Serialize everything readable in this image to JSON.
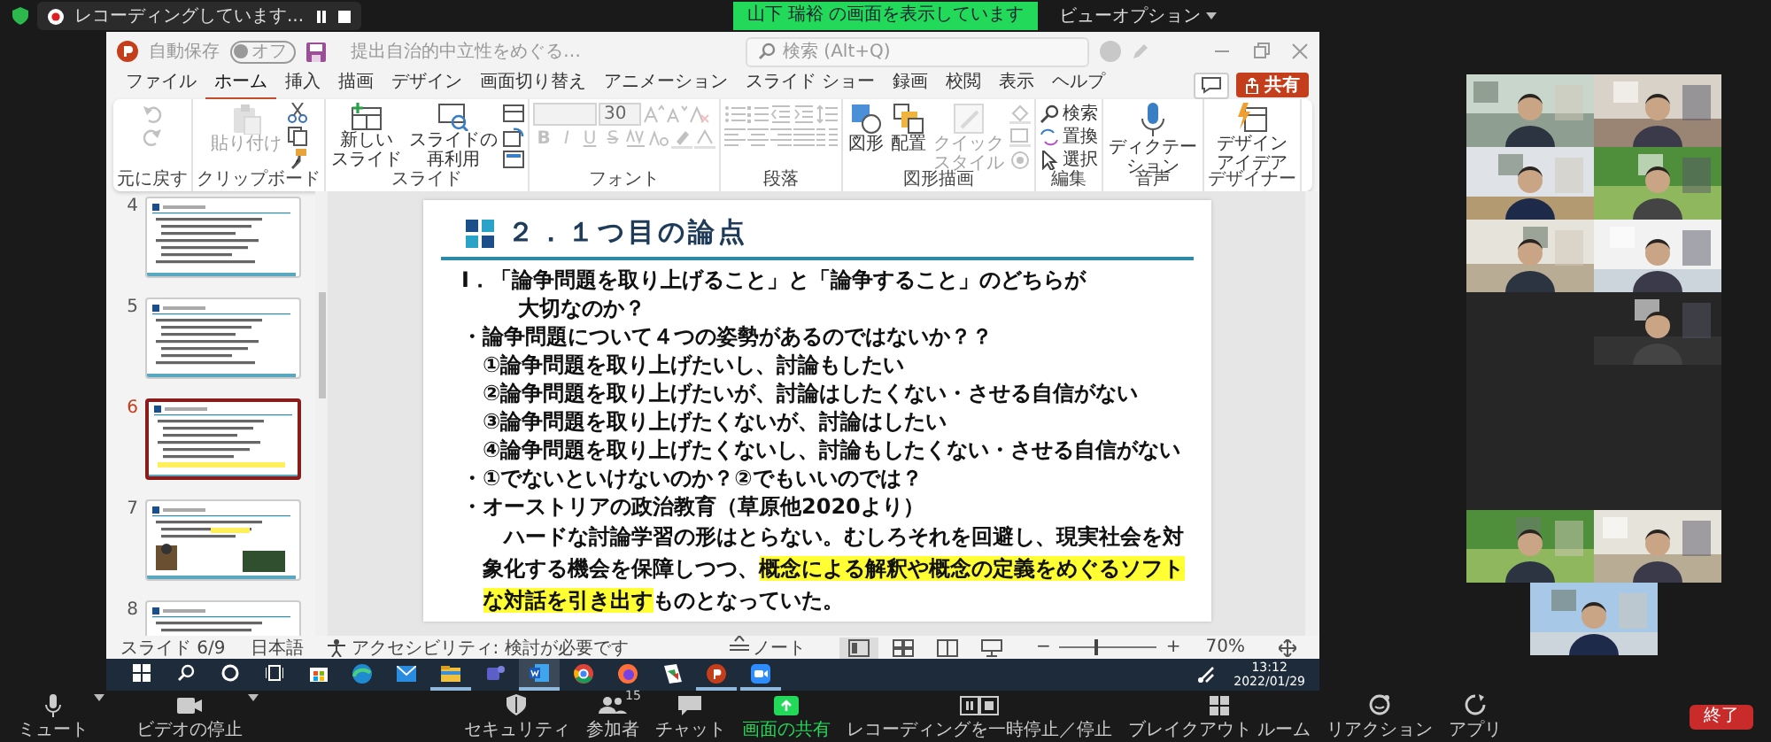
{
  "zoom_top": {
    "recording": "レコーディングしています...",
    "share_banner": "山下 瑞裕 の画面を表示しています",
    "view_options": "ビューオプション"
  },
  "powerpoint": {
    "autosave_label": "自動保存",
    "autosave": {
      "on": false,
      "label": "オフ"
    },
    "file_name": "提出自治的中立性をめぐる…",
    "search_placeholder": "検索 (Alt+Q)",
    "tabs": [
      {
        "label": "ファイル",
        "selected": false
      },
      {
        "label": "ホーム",
        "selected": true
      },
      {
        "label": "挿入",
        "selected": false
      },
      {
        "label": "描画",
        "selected": false
      },
      {
        "label": "デザイン",
        "selected": false
      },
      {
        "label": "画面切り替え",
        "selected": false
      },
      {
        "label": "アニメーション",
        "selected": false
      },
      {
        "label": "スライド ショー",
        "selected": false
      },
      {
        "label": "録画",
        "selected": false
      },
      {
        "label": "校閲",
        "selected": false
      },
      {
        "label": "表示",
        "selected": false
      },
      {
        "label": "ヘルプ",
        "selected": false
      }
    ],
    "share_button": "共有",
    "ribbon": [
      {
        "label": "元に戻す",
        "items": [
          {
            "kind": "stack",
            "rows": [
              {
                "buttons": [
                  {
                    "kind": "undo",
                    "disabled": true
                  }
                ]
              },
              {
                "buttons": [
                  {
                    "kind": "redo",
                    "disabled": true
                  }
                ]
              }
            ]
          }
        ]
      },
      {
        "label": "クリップボード",
        "items": [
          {
            "kind": "paste",
            "label": [
              "貼り付け"
            ],
            "disabled": true
          },
          {
            "kind": "stack",
            "rows": [
              {
                "buttons": [
                  {
                    "kind": "cut",
                    "disabled": false
                  }
                ]
              },
              {
                "buttons": [
                  {
                    "kind": "copy",
                    "disabled": false
                  }
                ]
              },
              {
                "buttons": [
                  {
                    "kind": "format_painter",
                    "disabled": false
                  }
                ]
              }
            ]
          }
        ]
      },
      {
        "label": "スライド",
        "items": [
          {
            "kind": "new_slide",
            "label": [
              "新しい",
              "スライド"
            ],
            "disabled": false
          },
          {
            "kind": "reuse_slides",
            "label": [
              "スライドの",
              "再利用"
            ],
            "disabled": false
          },
          {
            "kind": "stack",
            "rows": [
              {
                "buttons": [
                  {
                    "kind": "layout",
                    "disabled": false
                  }
                ]
              },
              {
                "buttons": [
                  {
                    "kind": "reset",
                    "disabled": false
                  }
                ]
              },
              {
                "buttons": [
                  {
                    "kind": "section",
                    "disabled": false
                  }
                ]
              }
            ]
          }
        ]
      },
      {
        "label": "フォント",
        "items": [
          {
            "kind": "stack",
            "rows": [
              {
                "buttons": [
                  {
                    "kind": "font_name",
                    "disabled": true
                  },
                  {
                    "kind": "font_size",
                    "value": "30",
                    "disabled": true
                  },
                  {
                    "kind": "grow",
                    "disabled": true
                  },
                  {
                    "kind": "shrink",
                    "disabled": true
                  },
                  {
                    "kind": "clear_format",
                    "disabled": true
                  }
                ]
              },
              {
                "buttons": [
                  {
                    "kind": "bold",
                    "label": "B",
                    "disabled": true
                  },
                  {
                    "kind": "italic",
                    "label": "I",
                    "disabled": true
                  },
                  {
                    "kind": "underline",
                    "label": "U",
                    "disabled": true
                  },
                  {
                    "kind": "strike",
                    "label": "S",
                    "disabled": true
                  },
                  {
                    "kind": "char_spacing",
                    "disabled": true
                  },
                  {
                    "kind": "change_case",
                    "disabled": true
                  },
                  {
                    "kind": "highlighter",
                    "disabled": true
                  },
                  {
                    "kind": "font_color",
                    "disabled": true
                  }
                ]
              }
            ]
          }
        ]
      },
      {
        "label": "段落",
        "items": [
          {
            "kind": "stack",
            "rows": [
              {
                "buttons": [
                  {
                    "kind": "bullets",
                    "disabled": true
                  },
                  {
                    "kind": "numbering",
                    "disabled": true
                  },
                  {
                    "kind": "indent_less",
                    "disabled": true
                  },
                  {
                    "kind": "indent_more",
                    "disabled": true
                  },
                  {
                    "kind": "line_spacing",
                    "disabled": true
                  }
                ]
              },
              {
                "buttons": [
                  {
                    "kind": "align_left",
                    "disabled": true
                  },
                  {
                    "kind": "align_center",
                    "disabled": true
                  },
                  {
                    "kind": "align_right",
                    "disabled": true
                  },
                  {
                    "kind": "justify",
                    "disabled": true
                  },
                  {
                    "kind": "columns",
                    "disabled": true
                  }
                ]
              }
            ]
          }
        ]
      },
      {
        "label": "図形描画",
        "items": [
          {
            "kind": "shapes",
            "label": [
              "図形"
            ],
            "disabled": false
          },
          {
            "kind": "arrange",
            "label": [
              "配置"
            ],
            "disabled": false
          },
          {
            "kind": "quick_styles",
            "label": [
              "クイック",
              "スタイル"
            ],
            "disabled": true
          },
          {
            "kind": "stack",
            "rows": [
              {
                "buttons": [
                  {
                    "kind": "fill",
                    "disabled": true
                  }
                ]
              },
              {
                "buttons": [
                  {
                    "kind": "outline",
                    "disabled": true
                  }
                ]
              },
              {
                "buttons": [
                  {
                    "kind": "effects",
                    "disabled": true
                  }
                ]
              }
            ]
          }
        ]
      },
      {
        "label": "編集",
        "items": [
          {
            "kind": "stack",
            "rows": [
              {
                "buttons": [
                  {
                    "kind": "find",
                    "label": "検索",
                    "disabled": false
                  }
                ]
              },
              {
                "buttons": [
                  {
                    "kind": "replace",
                    "label": "置換",
                    "disabled": false
                  }
                ]
              },
              {
                "buttons": [
                  {
                    "kind": "select",
                    "label": "選択",
                    "disabled": false
                  }
                ]
              }
            ]
          }
        ]
      },
      {
        "label": "音声",
        "items": [
          {
            "kind": "dictate",
            "label": [
              "ディクテー",
              "ション"
            ],
            "disabled": false
          }
        ]
      },
      {
        "label": "デザイナー",
        "items": [
          {
            "kind": "designer",
            "label": [
              "デザイン",
              "アイデア"
            ],
            "disabled": false
          }
        ]
      }
    ],
    "thumbnails": [
      {
        "number": "4",
        "selected": false,
        "kind": "text"
      },
      {
        "number": "5",
        "selected": false,
        "kind": "text"
      },
      {
        "number": "6",
        "selected": true,
        "kind": "text"
      },
      {
        "number": "7",
        "selected": false,
        "kind": "images"
      },
      {
        "number": "8",
        "selected": false,
        "kind": "text"
      }
    ],
    "slide": {
      "title": "２．１つ目の論点",
      "lines": [
        {
          "kind": "question",
          "text": "Ⅰ．「論争問題を取り上げること」と「論争すること」のどちらが"
        },
        {
          "kind": "continuation",
          "text": "大切なのか？"
        },
        {
          "kind": "bullet",
          "text": "・論争問題について４つの姿勢があるのではないか？？"
        },
        {
          "kind": "item",
          "text": "①論争問題を取り上げたいし、討論もしたい"
        },
        {
          "kind": "item",
          "text": "②論争問題を取り上げたいが、討論はしたくない・させる自信がない"
        },
        {
          "kind": "item",
          "text": "③論争問題を取り上げたくないが、討論はしたい"
        },
        {
          "kind": "item",
          "text": "④論争問題を取り上げたくないし、討論もしたくない・させる自信がない"
        },
        {
          "kind": "bullet",
          "text": "・①でないといけないのか？②でもいいのでは？"
        },
        {
          "kind": "bullet",
          "text": "・オーストリアの政治教育（草原他2020より）"
        },
        {
          "kind": "paragraph",
          "segments": [
            {
              "text": "ハードな討論学習の形はとらない。むしろそれを回避し、現実社会を対象化する機会を保障しつつ、",
              "highlight": false
            },
            {
              "text": "概念による解釈や概念の定義をめぐるソフトな対話を引き出す",
              "highlight": true
            },
            {
              "text": "ものとなっていた。",
              "highlight": false
            }
          ]
        }
      ]
    },
    "status": {
      "slide_number": "スライド 6/9",
      "language": "日本語",
      "accessibility": "アクセシビリティ: 検討が必要です",
      "notes": "ノート",
      "views": [
        {
          "kind": "normal",
          "selected": true
        },
        {
          "kind": "sorter",
          "selected": false
        },
        {
          "kind": "reading",
          "selected": false
        },
        {
          "kind": "slideshow",
          "selected": false
        }
      ],
      "zoom_out": "−",
      "zoom_in": "+",
      "zoom": {
        "level": 0.35
      },
      "zoom_text": "70%"
    }
  },
  "taskbar": {
    "apps": [
      {
        "kind": "start",
        "running": false,
        "active": false
      },
      {
        "kind": "search",
        "running": false,
        "active": false
      },
      {
        "kind": "cortana",
        "running": false,
        "active": false
      },
      {
        "kind": "taskview",
        "running": false,
        "active": false
      },
      {
        "kind": "store",
        "running": false,
        "active": false
      },
      {
        "kind": "edge",
        "running": false,
        "active": false
      },
      {
        "kind": "mail",
        "running": false,
        "active": false
      },
      {
        "kind": "explorer",
        "running": true,
        "active": false
      },
      {
        "kind": "teams",
        "running": false,
        "active": false
      },
      {
        "kind": "word",
        "running": true,
        "active": true
      },
      {
        "kind": "chrome",
        "running": false,
        "active": false
      },
      {
        "kind": "firefox",
        "running": false,
        "active": false
      },
      {
        "kind": "app",
        "running": false,
        "active": false
      },
      {
        "kind": "powerpoint",
        "running": true,
        "active": false
      },
      {
        "kind": "zoom",
        "running": true,
        "active": false
      }
    ],
    "time": "13:12",
    "date": "2022/01/29"
  },
  "gallery": [
    {
      "kind": "video"
    },
    {
      "kind": "video"
    },
    {
      "kind": "video"
    },
    {
      "kind": "video"
    },
    {
      "kind": "video"
    },
    {
      "kind": "video"
    },
    {
      "kind": "camera_off"
    },
    {
      "kind": "video"
    },
    {
      "kind": "camera_off"
    },
    {
      "kind": "camera_off"
    },
    {
      "kind": "camera_off"
    },
    {
      "kind": "camera_off"
    },
    {
      "kind": "video"
    },
    {
      "kind": "video"
    },
    {
      "kind": "video"
    }
  ],
  "toolbar": {
    "left": [
      {
        "kind": "mute",
        "label": "ミュート"
      },
      {
        "kind": "video",
        "label": "ビデオの停止"
      }
    ],
    "center": [
      {
        "kind": "security",
        "label": "セキュリティ"
      },
      {
        "kind": "participants",
        "label": "参加者",
        "count": "15"
      },
      {
        "kind": "chat",
        "label": "チャット"
      },
      {
        "kind": "share",
        "label": "画面の共有"
      },
      {
        "kind": "recording",
        "label": "レコーディングを一時停止／停止"
      },
      {
        "kind": "breakout",
        "label": "ブレイクアウト ルーム"
      },
      {
        "kind": "reactions",
        "label": "リアクション"
      },
      {
        "kind": "apps",
        "label": "アプリ"
      }
    ],
    "end": "終了"
  }
}
